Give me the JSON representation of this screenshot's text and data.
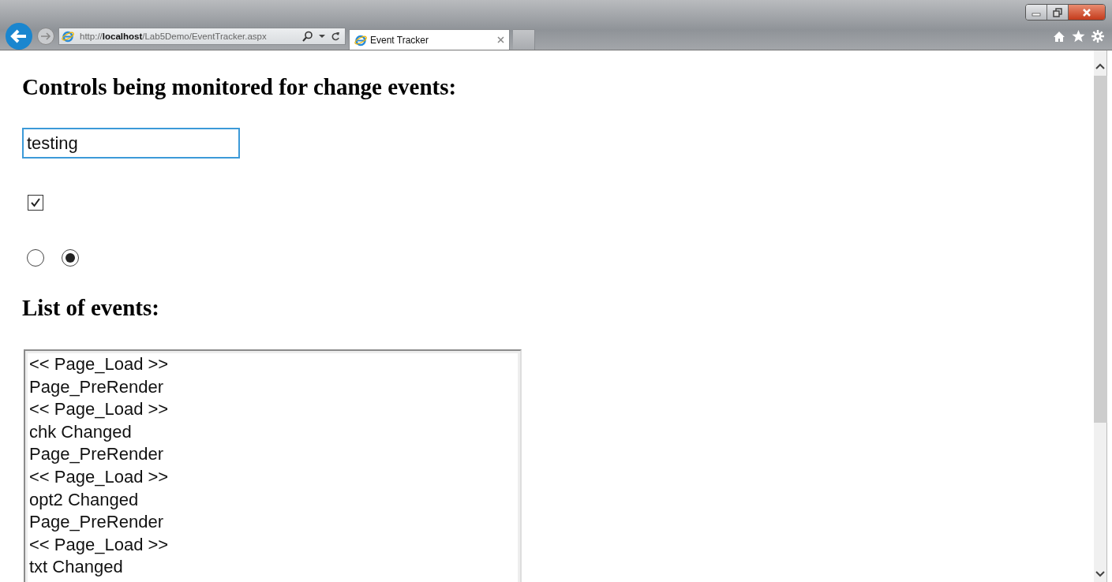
{
  "browser": {
    "address": "http://**localhost**/Lab5Demo/EventTracker.aspx",
    "tabs": [
      {
        "label": "Event Tracker",
        "selected": true
      }
    ]
  },
  "page": {
    "heading": "Controls being monitored for change events:",
    "text_field": {
      "value": "testing"
    },
    "checkbox": {
      "checked": true
    },
    "radios": [
      {
        "selected": false
      },
      {
        "selected": true
      }
    ],
    "list_heading": "List of events:",
    "events": [
      "<< Page_Load >>",
      "Page_PreRender",
      "<< Page_Load >>",
      "chk Changed",
      "Page_PreRender",
      "<< Page_Load >>",
      "opt2 Changed",
      "Page_PreRender",
      "<< Page_Load >>",
      "txt Changed"
    ]
  }
}
